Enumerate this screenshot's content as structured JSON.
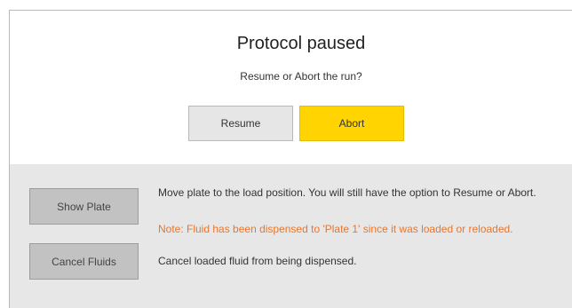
{
  "dialog": {
    "title": "Protocol paused",
    "subtitle": "Resume or Abort the run?",
    "resume_label": "Resume",
    "abort_label": "Abort"
  },
  "options": {
    "show_plate": {
      "label": "Show Plate",
      "description": "Move plate to the load position. You will still have the option to Resume or Abort.",
      "note": "Note: Fluid has been dispensed to 'Plate 1' since it was loaded or reloaded."
    },
    "cancel_fluids": {
      "label": "Cancel Fluids",
      "description": "Cancel loaded fluid from being dispensed."
    }
  },
  "colors": {
    "abort_button": "#ffd400",
    "note_text": "#e8762d",
    "panel_background": "#e7e7e7"
  }
}
